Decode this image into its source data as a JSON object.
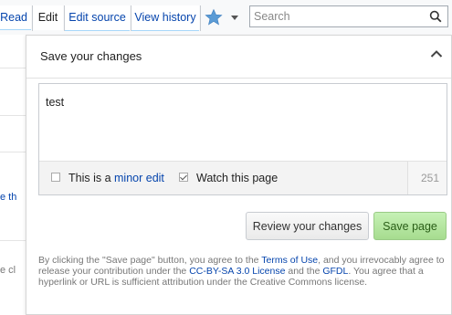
{
  "tabs": {
    "read": "Read",
    "edit": "Edit",
    "edit_source": "Edit source",
    "view_history": "View history"
  },
  "search": {
    "placeholder": "Search"
  },
  "left_fragments": {
    "one": "e th",
    "two": "e cl"
  },
  "dialog": {
    "title": "Save your changes",
    "summary_text": "test",
    "minor_edit_prefix": "This is a ",
    "minor_edit_link": "minor edit",
    "minor_edit_checked": false,
    "watch_label": "Watch this page",
    "watch_checked": true,
    "char_counter": "251",
    "review_button": "Review your changes",
    "save_button": "Save page"
  },
  "legal": {
    "t1": "By clicking the \"Save page\" button, you agree to the ",
    "terms": "Terms of Use",
    "t2": ", and you irrevocably agree to release your contribution under the ",
    "license": "CC-BY-SA 3.0 License",
    "t3": " and the ",
    "gfdl": "GFDL",
    "t4": ". You agree that a hyperlink or URL is sufficient attribution under the Creative Commons license."
  },
  "colors": {
    "link": "#0645ad",
    "save_button_bg": "#a6dc8f",
    "star": "#5b9bd5"
  },
  "icons": [
    "star-icon",
    "chevron-down-icon",
    "search-icon",
    "collapse-chevron-up-icon",
    "checkbox-icon"
  ]
}
